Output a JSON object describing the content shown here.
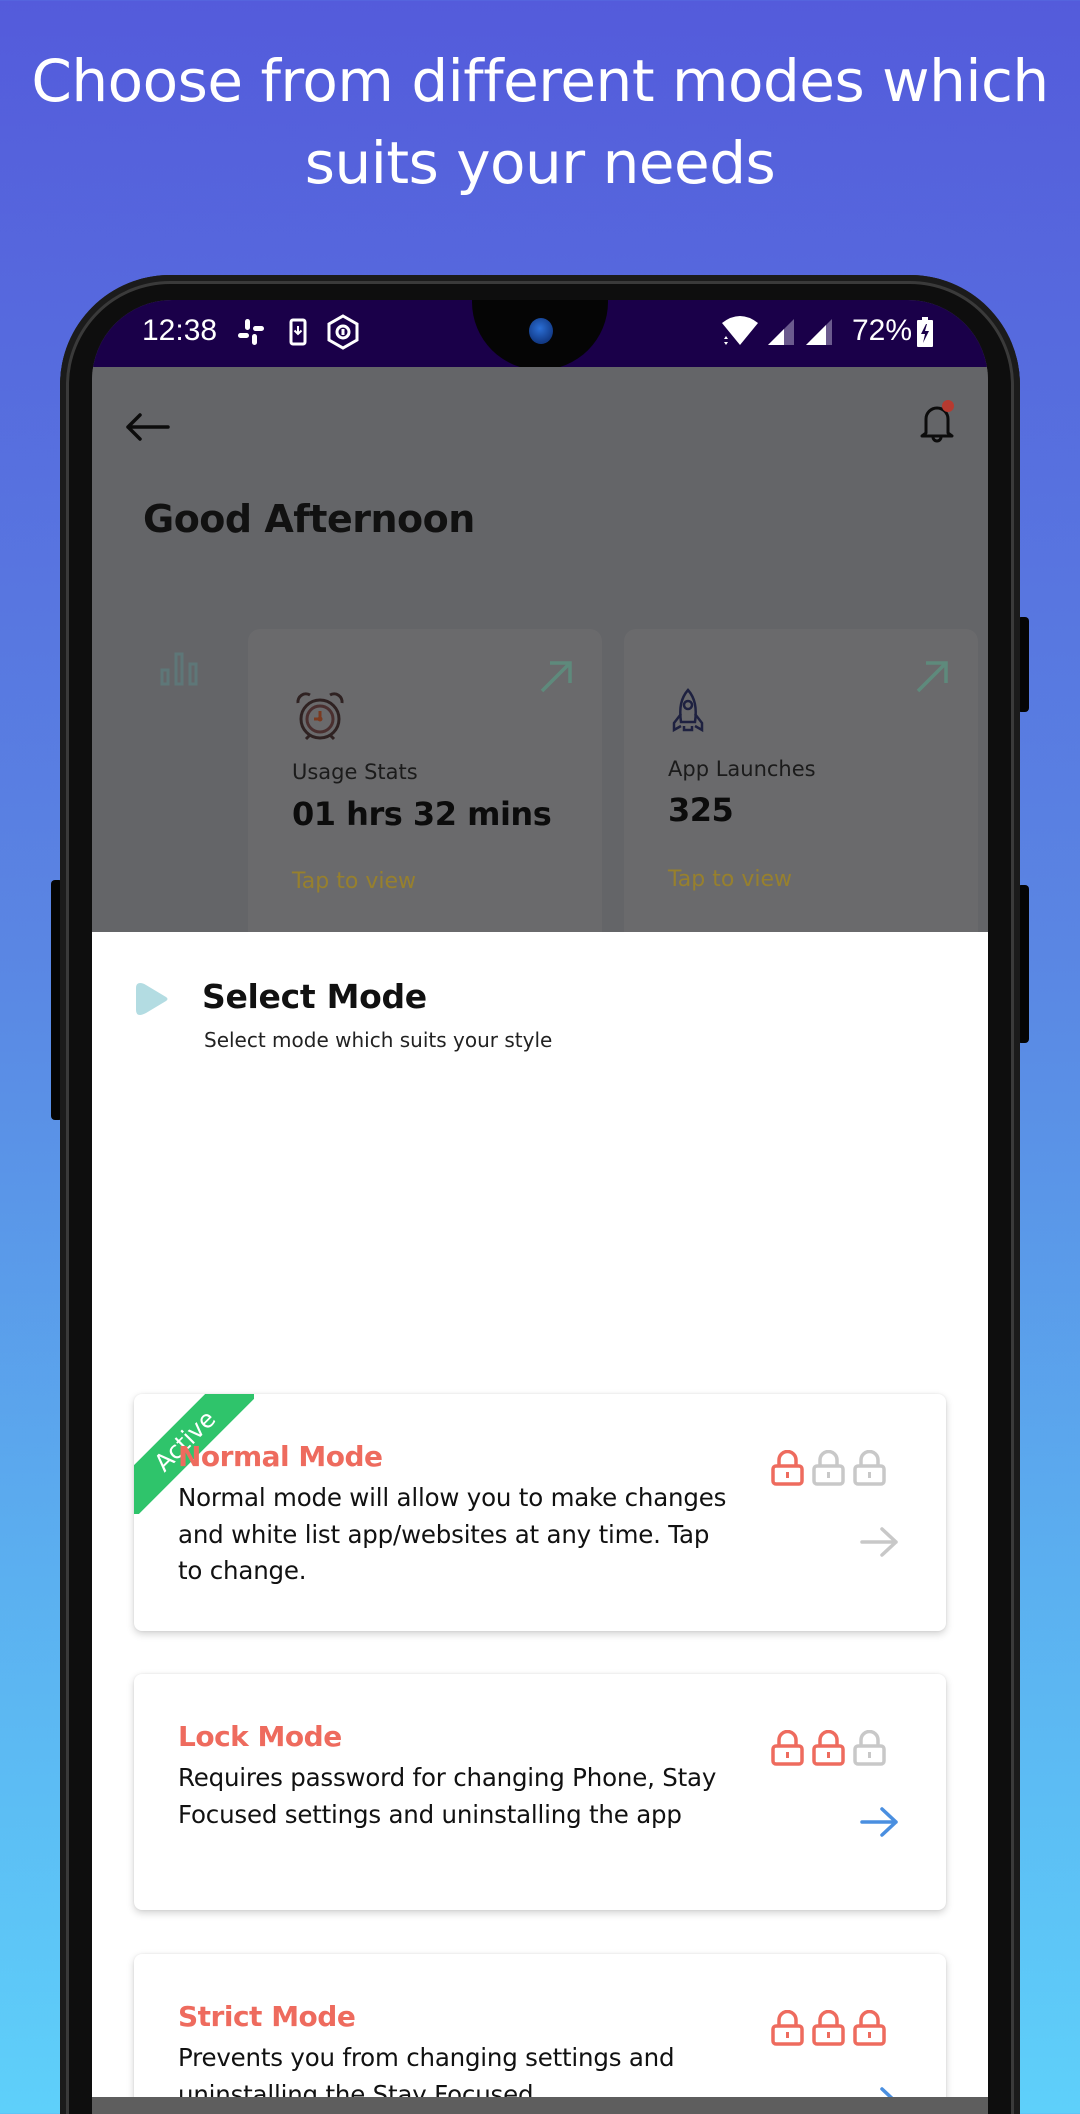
{
  "headline": {
    "line1": "Choose from different modes which",
    "line2": "suits your needs"
  },
  "status_bar": {
    "time": "12:38",
    "left_icons": [
      "slack-icon",
      "download-to-device-icon",
      "vpn-shield-icon"
    ],
    "right_icons": [
      "wifi-icon",
      "signal-icon",
      "signal-icon"
    ],
    "battery_percent": "72%",
    "battery_state": "charging"
  },
  "app": {
    "greeting": "Good Afternoon",
    "notification_badge_color": "#C0392B",
    "stats": [
      {
        "label": "Usage Stats",
        "value": "01 hrs 32 mins",
        "link": "Tap to view",
        "icon": "alarm-clock-icon"
      },
      {
        "label": "App Launches",
        "value": "325",
        "link": "Tap to view",
        "icon": "rocket-icon"
      }
    ]
  },
  "sheet": {
    "title": "Select Mode",
    "subtitle": "Select mode which suits your style",
    "active_badge": "Active",
    "modes": [
      {
        "title": "Normal Mode",
        "description": "Normal mode will allow you to make changes and white list app/websites at any time. Tap to change.",
        "lock_level": 1,
        "lock_max": 3,
        "active": true
      },
      {
        "title": "Lock Mode",
        "description": "Requires password for changing Phone, Stay Focused settings and uninstalling the app",
        "lock_level": 2,
        "lock_max": 3,
        "active": false
      },
      {
        "title": "Strict Mode",
        "description": "Prevents you from changing settings and uninstalling the Stay Focused",
        "lock_level": 3,
        "lock_max": 3,
        "active": false
      }
    ]
  },
  "colors": {
    "mode_title": "#EE6B5E",
    "lock_on": "#EE6B5E",
    "lock_off": "#C8C8C8",
    "arrow_active": "#4A8FE0",
    "arrow_inactive": "#C8C8C8",
    "ribbon": "#2FC46B",
    "status_bar": "#1A0049"
  }
}
